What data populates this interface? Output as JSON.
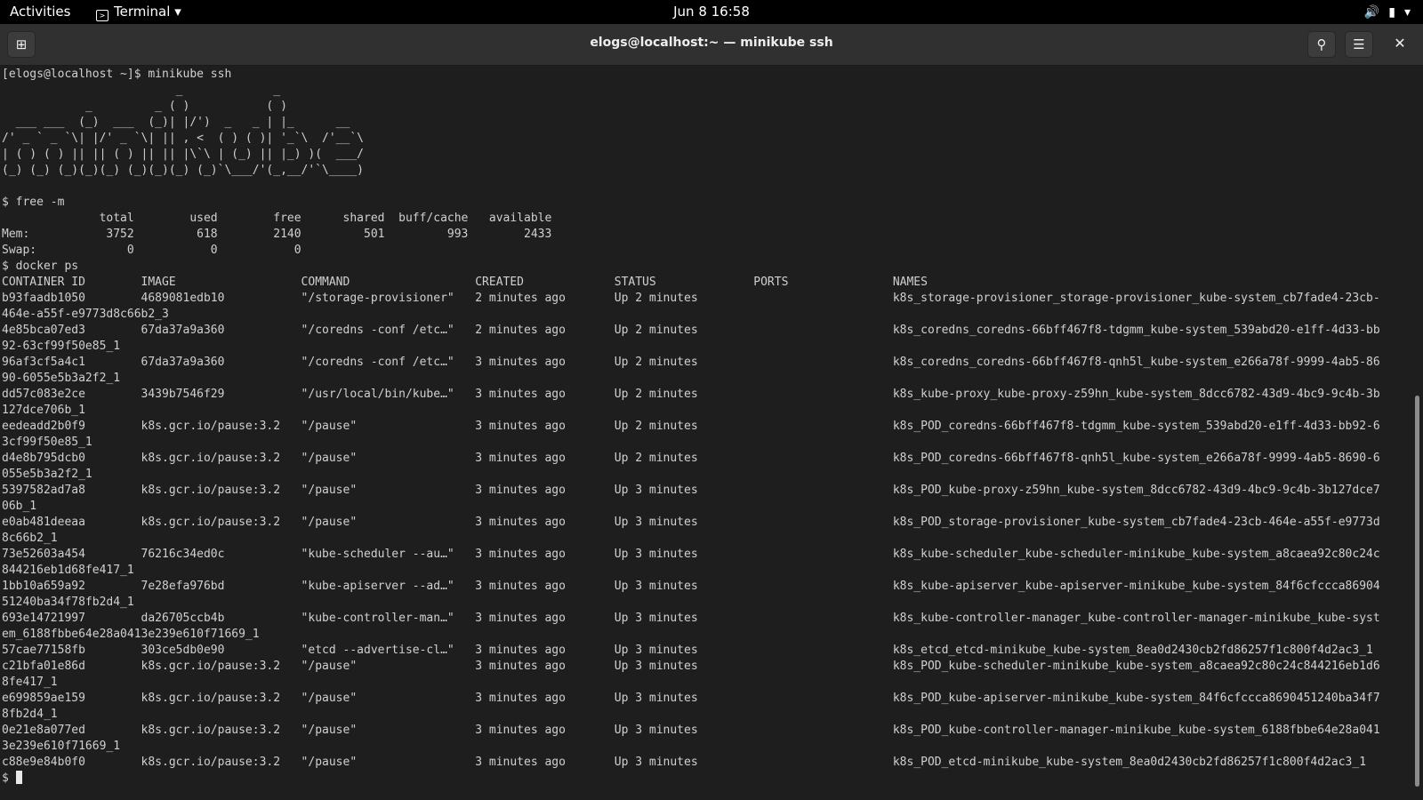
{
  "topbar": {
    "activities": "Activities",
    "app_menu": "Terminal",
    "clock": "Jun 8  16:58"
  },
  "window": {
    "title": "elogs@localhost:~ — minikube ssh"
  },
  "terminal": {
    "lines": [
      "[elogs@localhost ~]$ minikube ssh",
      "                         _             _",
      "            _         _ ( )           ( )",
      "  ___ ___  (_)  ___  (_)| |/')  _   _ | |_      __",
      "/' _ ` _ `\\| |/' _ `\\| || , <  ( ) ( )| '_`\\  /'__`\\",
      "| ( ) ( ) || || ( ) || || |\\`\\ | (_) || |_) )(  ___/",
      "(_) (_) (_)(_)(_) (_)(_)(_) (_)`\\___/'(_,__/'`\\____)",
      "",
      "$ free -m",
      "              total        used        free      shared  buff/cache   available",
      "Mem:           3752         618        2140         501         993        2433",
      "Swap:             0           0           0",
      "$ docker ps",
      "CONTAINER ID        IMAGE                  COMMAND                  CREATED             STATUS              PORTS               NAMES",
      "b93faadb1050        4689081edb10           \"/storage-provisioner\"   2 minutes ago       Up 2 minutes                            k8s_storage-provisioner_storage-provisioner_kube-system_cb7fade4-23cb-",
      "464e-a55f-e9773d8c66b2_3",
      "4e85bca07ed3        67da37a9a360           \"/coredns -conf /etc…\"   2 minutes ago       Up 2 minutes                            k8s_coredns_coredns-66bff467f8-tdgmm_kube-system_539abd20-e1ff-4d33-bb",
      "92-63cf99f50e85_1",
      "96af3cf5a4c1        67da37a9a360           \"/coredns -conf /etc…\"   3 minutes ago       Up 2 minutes                            k8s_coredns_coredns-66bff467f8-qnh5l_kube-system_e266a78f-9999-4ab5-86",
      "90-6055e5b3a2f2_1",
      "dd57c083e2ce        3439b7546f29           \"/usr/local/bin/kube…\"   3 minutes ago       Up 2 minutes                            k8s_kube-proxy_kube-proxy-z59hn_kube-system_8dcc6782-43d9-4bc9-9c4b-3b",
      "127dce706b_1",
      "eedeadd2b0f9        k8s.gcr.io/pause:3.2   \"/pause\"                 3 minutes ago       Up 2 minutes                            k8s_POD_coredns-66bff467f8-tdgmm_kube-system_539abd20-e1ff-4d33-bb92-6",
      "3cf99f50e85_1",
      "d4e8b795dcb0        k8s.gcr.io/pause:3.2   \"/pause\"                 3 minutes ago       Up 2 minutes                            k8s_POD_coredns-66bff467f8-qnh5l_kube-system_e266a78f-9999-4ab5-8690-6",
      "055e5b3a2f2_1",
      "5397582ad7a8        k8s.gcr.io/pause:3.2   \"/pause\"                 3 minutes ago       Up 3 minutes                            k8s_POD_kube-proxy-z59hn_kube-system_8dcc6782-43d9-4bc9-9c4b-3b127dce7",
      "06b_1",
      "e0ab481deeaa        k8s.gcr.io/pause:3.2   \"/pause\"                 3 minutes ago       Up 3 minutes                            k8s_POD_storage-provisioner_kube-system_cb7fade4-23cb-464e-a55f-e9773d",
      "8c66b2_1",
      "73e52603a454        76216c34ed0c           \"kube-scheduler --au…\"   3 minutes ago       Up 3 minutes                            k8s_kube-scheduler_kube-scheduler-minikube_kube-system_a8caea92c80c24c",
      "844216eb1d68fe417_1",
      "1bb10a659a92        7e28efa976bd           \"kube-apiserver --ad…\"   3 minutes ago       Up 3 minutes                            k8s_kube-apiserver_kube-apiserver-minikube_kube-system_84f6cfccca86904",
      "51240ba34f78fb2d4_1",
      "693e14721997        da26705ccb4b           \"kube-controller-man…\"   3 minutes ago       Up 3 minutes                            k8s_kube-controller-manager_kube-controller-manager-minikube_kube-syst",
      "em_6188fbbe64e28a0413e239e610f71669_1",
      "57cae77158fb        303ce5db0e90           \"etcd --advertise-cl…\"   3 minutes ago       Up 3 minutes                            k8s_etcd_etcd-minikube_kube-system_8ea0d2430cb2fd86257f1c800f4d2ac3_1",
      "c21bfa01e86d        k8s.gcr.io/pause:3.2   \"/pause\"                 3 minutes ago       Up 3 minutes                            k8s_POD_kube-scheduler-minikube_kube-system_a8caea92c80c24c844216eb1d6",
      "8fe417_1",
      "e699859ae159        k8s.gcr.io/pause:3.2   \"/pause\"                 3 minutes ago       Up 3 minutes                            k8s_POD_kube-apiserver-minikube_kube-system_84f6cfccca8690451240ba34f7",
      "8fb2d4_1",
      "0e21e8a077ed        k8s.gcr.io/pause:3.2   \"/pause\"                 3 minutes ago       Up 3 minutes                            k8s_POD_kube-controller-manager-minikube_kube-system_6188fbbe64e28a041",
      "3e239e610f71669_1",
      "c88e9e84b0f0        k8s.gcr.io/pause:3.2   \"/pause\"                 3 minutes ago       Up 3 minutes                            k8s_POD_etcd-minikube_kube-system_8ea0d2430cb2fd86257f1c800f4d2ac3_1"
    ],
    "prompt": "$ "
  }
}
